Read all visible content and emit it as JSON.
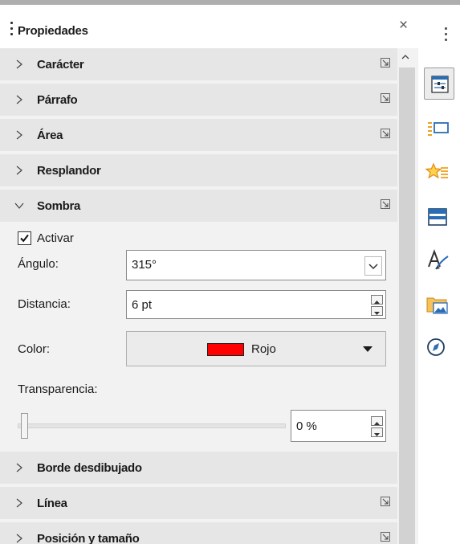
{
  "panel": {
    "title": "Propiedades",
    "close_glyph": "×",
    "sections_top": [
      {
        "label": "Carácter",
        "expanded": false,
        "has_more": true
      },
      {
        "label": "Párrafo",
        "expanded": false,
        "has_more": true
      },
      {
        "label": "Área",
        "expanded": false,
        "has_more": true
      },
      {
        "label": "Resplandor",
        "expanded": false,
        "has_more": false
      },
      {
        "label": "Sombra",
        "expanded": true,
        "has_more": true
      }
    ],
    "shadow": {
      "enable_label": "Activar",
      "enable_checked": true,
      "angle_label": "Ángulo:",
      "angle_value": "315°",
      "distance_label": "Distancia:",
      "distance_value": "6 pt",
      "color_label": "Color:",
      "color_name": "Rojo",
      "color_hex": "#ff0000",
      "transparency_label": "Transparencia:",
      "transparency_value": "0 %",
      "transparency_level": 0
    },
    "sections_bottom": [
      {
        "label": "Borde desdibujado",
        "expanded": false,
        "has_more": false
      },
      {
        "label": "Línea",
        "expanded": false,
        "has_more": true
      },
      {
        "label": "Posición y tamaño",
        "expanded": false,
        "has_more": true
      }
    ]
  },
  "deck": {
    "buttons": [
      {
        "name": "properties-icon",
        "active": true
      },
      {
        "name": "styles-icon",
        "active": false
      },
      {
        "name": "gallery-icon",
        "active": false
      },
      {
        "name": "slide-layout-icon",
        "active": false
      },
      {
        "name": "text-style-icon",
        "active": false
      },
      {
        "name": "image-folder-icon",
        "active": false
      },
      {
        "name": "navigator-icon",
        "active": false
      }
    ]
  },
  "colors": {
    "section_bg": "#e6e6e6",
    "panel_bg": "#f2f2f2",
    "accent_blue": "#2a6db5",
    "star_orange": "#f0a020"
  }
}
